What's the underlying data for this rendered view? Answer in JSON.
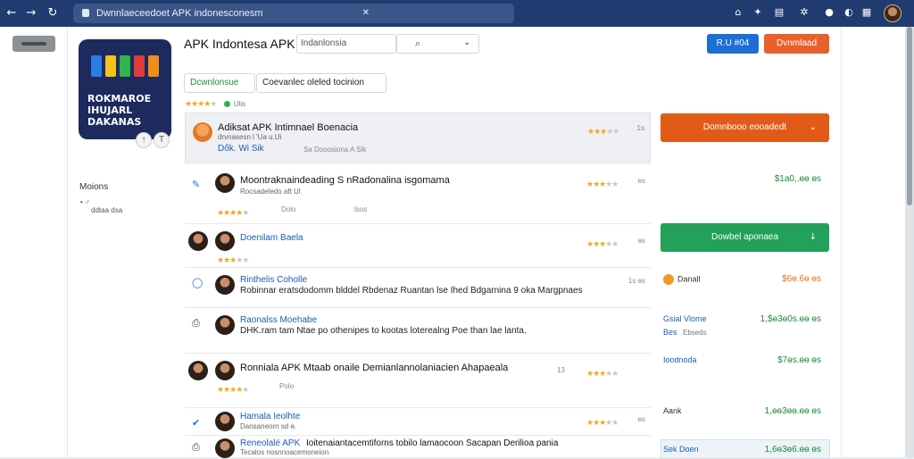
{
  "browser": {
    "url": "Dwnnlaeceedoet APK indonesconesm",
    "icons": [
      "back-icon",
      "forward-icon",
      "reload-icon",
      "lock-icon",
      "bookmark-icon",
      "extension-icon",
      "sparkle-icon",
      "document-icon",
      "puzzle-icon",
      "profile-icon",
      "calendar-icon"
    ]
  },
  "header": {
    "title": "APK Indontesa APK",
    "search_value": "Indanlonsia",
    "btn_primary": "R.U #04",
    "btn_download": "Dvnmlaad"
  },
  "app_icon": {
    "text": "ROKMAROE IHUJARL DAKANAS"
  },
  "sidebar": {
    "label": "Moions",
    "sub1": "•  ♂",
    "sub2": "ddtaa dsa"
  },
  "tabs": [
    {
      "label": "Dcwnlonsue"
    },
    {
      "label": "Coevanlec oleled tocinion"
    }
  ],
  "rating_summary": {
    "stars": 4,
    "text": "Ulis"
  },
  "rows": [
    {
      "title": "Adiksat APK Intimnael Boenacia",
      "sub": "drvnasesn l 'Ua u.Ui",
      "link": "Dők. Wi Sik",
      "meta": "Sa Dooosiona A Sik",
      "right": "1s",
      "stars": 3
    },
    {
      "title": "Moontraknaindeading S nRadonalina isgomama",
      "sub": "Rocsadeledo aft Ul",
      "meta1": "Dolo",
      "meta2": "lsos",
      "right": "ɵs",
      "stars": 4
    },
    {
      "title": "Doenilam Baela",
      "right": "ɵs",
      "stars": 3
    },
    {
      "title": "Rinthelis Coholle",
      "sub": "Robinnar eratsdodomm blddel Rbdenaz Ruantan lse Ihed Bdgarnina 9 oka Margpnaes",
      "right": "1s ɵs"
    },
    {
      "title": "Raonalss Moehabe",
      "sub": "DHK.ram tam Ntae po othenipes to kootas loterealng Poe than lae lanta."
    },
    {
      "title": "Ronniala APK Mtaab onaile Demianlannolaniacien Ahapaeala",
      "meta": "Polo",
      "right": "13",
      "stars": 4
    },
    {
      "title": "Hamala Ieolhte",
      "sub": "Dansaneorn sd ɵ.",
      "right": "ɵs",
      "stars": 3
    },
    {
      "title": "Reneolalé APK",
      "sub": "Tecalos nosnnoacemoneion",
      "extra": "Ioitenaiantacemtiforns tobilo lamaocoon Sacapan Derilioa pania"
    }
  ],
  "side_panel": {
    "dl_orange": "Domnbooo eooadedt",
    "dl_green": "Dowbel aponaea",
    "prices": [
      "$1a0,.ɵɵ ɵs",
      "$6ɵ.6ɵ ɵs",
      "1,$ɵ3ɵ0s.ɵɵ ɵs",
      "$7ɵs.ɵɵ ɵs",
      "1,ɵɵ3ɵɵ.ɵɵ ɵs",
      "1,6ɵ3ɵ6.ɵɵ ɵs"
    ],
    "labels": [
      "Danall",
      "Gsial Vlome",
      "Bes",
      "Ioodnoda",
      "Aank",
      "Sek Doen"
    ],
    "sub_labels": [
      "Ebseds"
    ]
  }
}
